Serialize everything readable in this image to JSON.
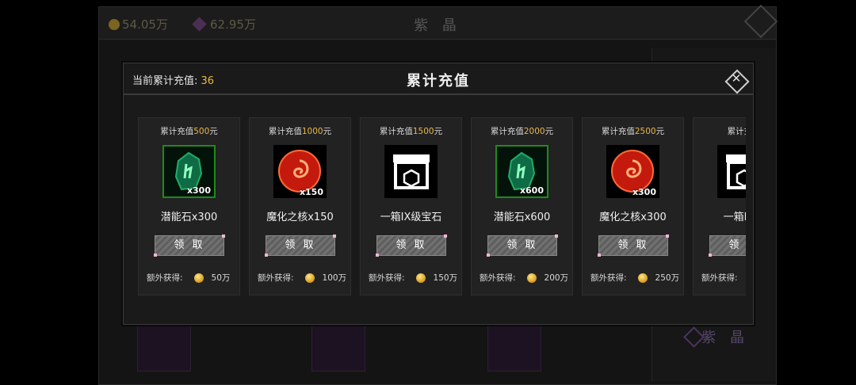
{
  "background": {
    "gold": "54.05万",
    "gems": "62.95万",
    "title": "紫 晶",
    "category": "紫 晶"
  },
  "modal": {
    "current_label": "当前累计充值:",
    "current_value": "36",
    "title": "累计充值",
    "close_icon": "close-icon",
    "claim_label": "领 取",
    "extra_label": "额外获得:",
    "cards": [
      {
        "req_prefix": "累计充值",
        "req_amount": "500",
        "req_suffix": "元",
        "icon": "potential-stone-icon",
        "qty": "x300",
        "name": "潜能石x300",
        "extra": "50万"
      },
      {
        "req_prefix": "累计充值",
        "req_amount": "1000",
        "req_suffix": "元",
        "icon": "demon-core-icon",
        "qty": "x150",
        "name": "魔化之核x150",
        "extra": "100万"
      },
      {
        "req_prefix": "累计充值",
        "req_amount": "1500",
        "req_suffix": "元",
        "icon": "gem-chest-icon",
        "qty": "",
        "name": "一箱IX级宝石",
        "extra": "150万"
      },
      {
        "req_prefix": "累计充值",
        "req_amount": "2000",
        "req_suffix": "元",
        "icon": "potential-stone-icon",
        "qty": "x600",
        "name": "潜能石x600",
        "extra": "200万"
      },
      {
        "req_prefix": "累计充值",
        "req_amount": "2500",
        "req_suffix": "元",
        "icon": "demon-core-icon",
        "qty": "x300",
        "name": "魔化之核x300",
        "extra": "250万"
      },
      {
        "req_prefix": "累计充值",
        "req_amount": "",
        "req_suffix": "",
        "icon": "gem-chest-icon",
        "qty": "",
        "name": "一箱IX级",
        "extra": ""
      }
    ]
  },
  "colors": {
    "accent": "#e8b84a",
    "stone_border": "#1e8a1e"
  }
}
